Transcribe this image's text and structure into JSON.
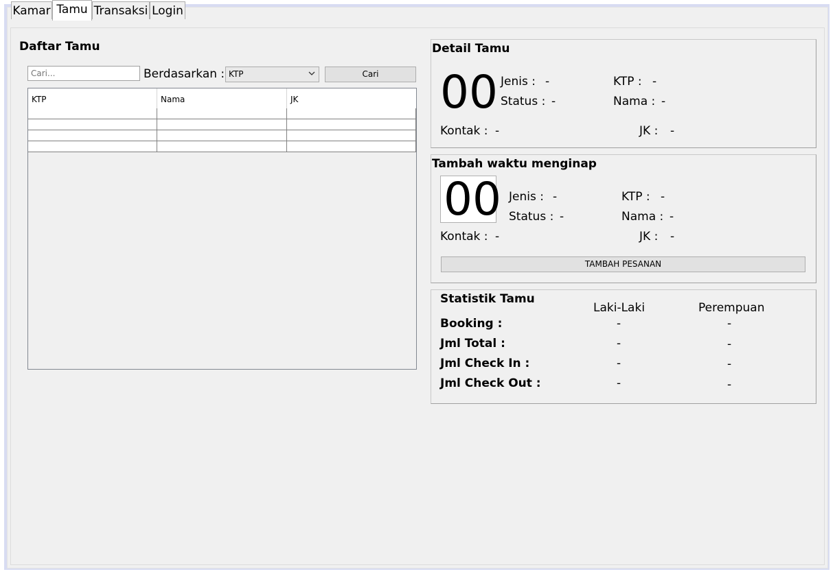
{
  "tabs": [
    "Kamar",
    "Tamu",
    "Transaksi",
    "Login"
  ],
  "daftar": {
    "title": "Daftar Tamu",
    "search_placeholder": "Cari...",
    "by_label": "Berdasarkan :",
    "by_selected": "KTP",
    "search_button": "Cari",
    "columns": [
      "KTP",
      "Nama",
      "JK"
    ]
  },
  "detail": {
    "title": "Detail Tamu",
    "number": "00",
    "jenis_label": "Jenis :",
    "jenis_value": "-",
    "status_label": "Status :",
    "status_value": "-",
    "ktp_label": "KTP :",
    "ktp_value": "-",
    "nama_label": "Nama :",
    "nama_value": "-",
    "kontak_label": "Kontak :",
    "kontak_value": "-",
    "jk_label": "JK :",
    "jk_value": "-"
  },
  "tambah": {
    "title": "Tambah waktu menginap",
    "number": "00",
    "jenis_label": "Jenis :",
    "jenis_value": "-",
    "status_label": "Status :",
    "status_value": "-",
    "ktp_label": "KTP :",
    "ktp_value": "-",
    "nama_label": "Nama :",
    "nama_value": "-",
    "kontak_label": "Kontak :",
    "kontak_value": "-",
    "jk_label": "JK :",
    "jk_value": "-",
    "button": "TAMBAH PESANAN"
  },
  "statistik": {
    "title": "Statistik Tamu",
    "col_male": "Laki-Laki",
    "col_female": "Perempuan",
    "rows": [
      {
        "label": "Booking :",
        "male": "-",
        "female": "-"
      },
      {
        "label": "Jml Total :",
        "male": "-",
        "female": "-"
      },
      {
        "label": "Jml Check In :",
        "male": "-",
        "female": "-"
      },
      {
        "label": "Jml Check Out :",
        "male": "-",
        "female": "-"
      }
    ]
  }
}
